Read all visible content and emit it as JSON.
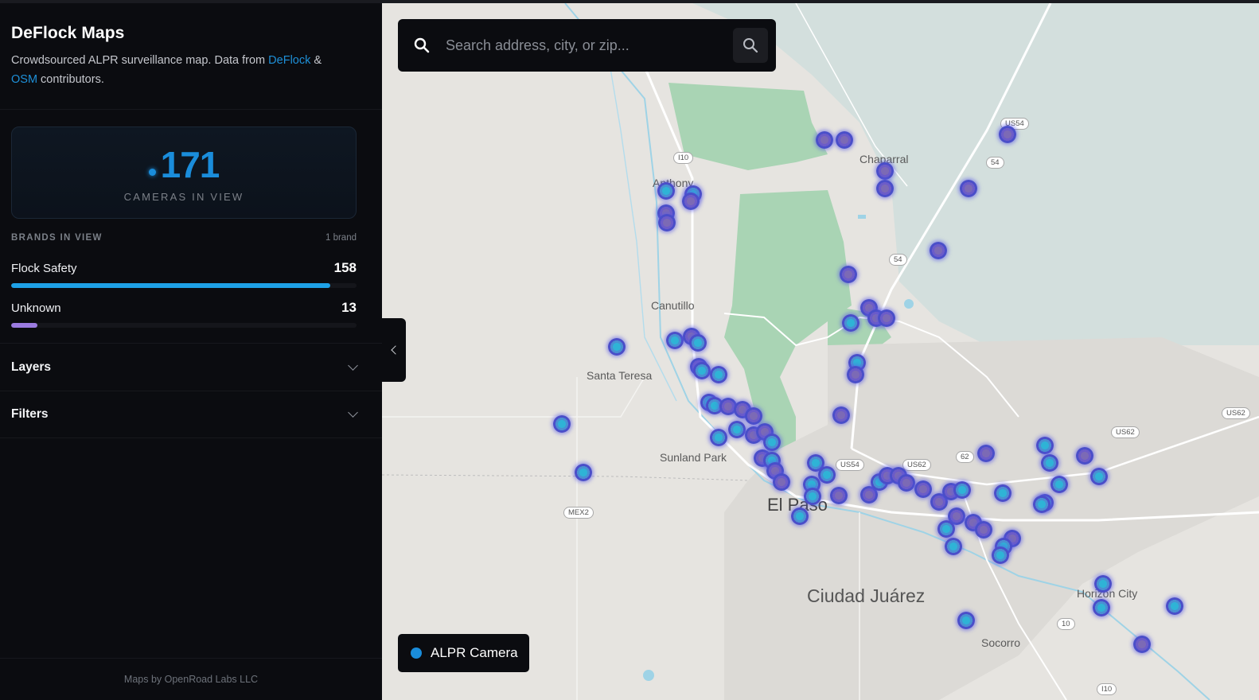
{
  "sidebar": {
    "title": "DeFlock Maps",
    "desc_prefix": "Crowdsourced ALPR surveillance map. Data from ",
    "link_deflock": "DeFlock",
    "desc_and": " & ",
    "link_osm": "OSM",
    "desc_suffix": " contributors.",
    "stat_value": "171",
    "stat_label": "CAMERAS IN VIEW",
    "brands_title": "BRANDS IN VIEW",
    "brands_count": "1 brand",
    "brands": [
      {
        "name": "Flock Safety",
        "count": "158",
        "fraction": 0.924,
        "color": "#1ea1e6"
      },
      {
        "name": "Unknown",
        "count": "13",
        "fraction": 0.076,
        "color": "#9b7be0"
      }
    ],
    "sections": [
      {
        "title": "Layers"
      },
      {
        "title": "Filters"
      }
    ],
    "footer": "Maps by OpenRoad Labs LLC"
  },
  "search": {
    "placeholder": "Search address, city, or zip..."
  },
  "legend": {
    "label": "ALPR Camera",
    "color": "#1a8ddb"
  },
  "map": {
    "places": [
      {
        "name": "Chaparral"
      },
      {
        "name": "Anthony"
      },
      {
        "name": "Canutillo"
      },
      {
        "name": "Santa Teresa"
      },
      {
        "name": "Sunland Park"
      },
      {
        "name": "El Paso"
      },
      {
        "name": "Ciudad Juárez"
      },
      {
        "name": "Horizon City"
      },
      {
        "name": "Socorro"
      }
    ],
    "shields": [
      "I10",
      "US54",
      "54",
      "54",
      "US54",
      "US62",
      "62",
      "US62",
      "US62",
      "MEX2",
      "10",
      "I10"
    ]
  }
}
